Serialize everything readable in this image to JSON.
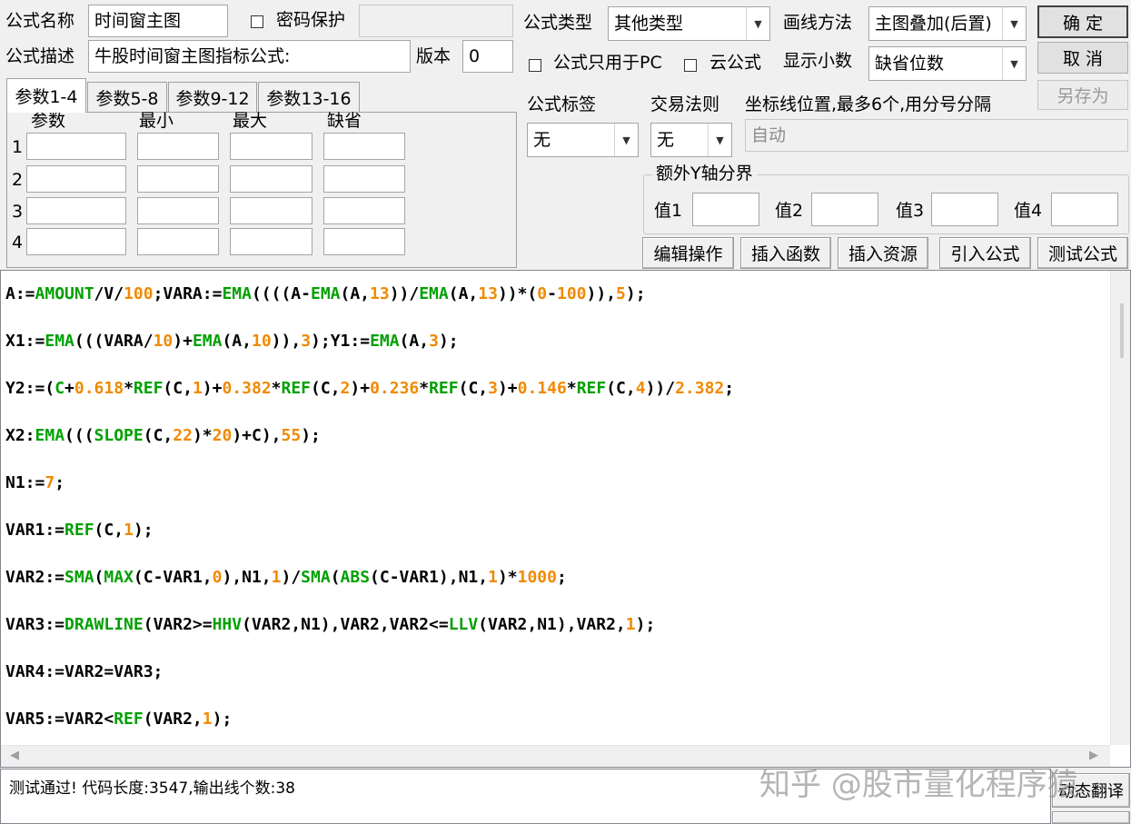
{
  "form": {
    "name_label": "公式名称",
    "name_value": "时间窗主图",
    "password_label": "密码保护",
    "type_label": "公式类型",
    "type_value": "其他类型",
    "draw_label": "画线方法",
    "draw_value": "主图叠加(后置)",
    "desc_label": "公式描述",
    "desc_value": "牛股时间窗主图指标公式:",
    "version_label": "版本",
    "version_value": "0",
    "pc_only_label": "公式只用于PC",
    "cloud_label": "云公式",
    "decimals_label": "显示小数",
    "decimals_value": "缺省位数",
    "tag_label": "公式标签",
    "tag_value": "无",
    "trade_rule_label": "交易法则",
    "trade_rule_value": "无",
    "coord_label": "坐标线位置,最多6个,用分号分隔",
    "coord_value": "自动",
    "extra_y_label": "额外Y轴分界",
    "val1": "值1",
    "val2": "值2",
    "val3": "值3",
    "val4": "值4"
  },
  "buttons": {
    "ok": "确 定",
    "cancel": "取 消",
    "save_as": "另存为",
    "edit_ops": "编辑操作",
    "insert_fn": "插入函数",
    "insert_res": "插入资源",
    "import": "引入公式",
    "test": "测试公式",
    "translate": "动态翻译"
  },
  "params": {
    "tabs": [
      "参数1-4",
      "参数5-8",
      "参数9-12",
      "参数13-16"
    ],
    "headers": [
      "参数",
      "最小",
      "最大",
      "缺省"
    ],
    "rows": [
      "1",
      "2",
      "3",
      "4"
    ]
  },
  "code": [
    [
      [
        "t",
        "A:="
      ],
      [
        "f",
        "AMOUNT"
      ],
      [
        "t",
        "/V/"
      ],
      [
        "n",
        "100"
      ],
      [
        "t",
        ";VARA:="
      ],
      [
        "f",
        "EMA"
      ],
      [
        "t",
        "((((A-"
      ],
      [
        "f",
        "EMA"
      ],
      [
        "t",
        "(A,"
      ],
      [
        "n",
        "13"
      ],
      [
        "t",
        "))/"
      ],
      [
        "f",
        "EMA"
      ],
      [
        "t",
        "(A,"
      ],
      [
        "n",
        "13"
      ],
      [
        "t",
        "))*("
      ],
      [
        "n",
        "0"
      ],
      [
        "t",
        "-"
      ],
      [
        "n",
        "100"
      ],
      [
        "t",
        ")),"
      ],
      [
        "n",
        "5"
      ],
      [
        "t",
        ");"
      ]
    ],
    [
      [
        "t",
        "X1:="
      ],
      [
        "f",
        "EMA"
      ],
      [
        "t",
        "(((VARA/"
      ],
      [
        "n",
        "10"
      ],
      [
        "t",
        ")+"
      ],
      [
        "f",
        "EMA"
      ],
      [
        "t",
        "(A,"
      ],
      [
        "n",
        "10"
      ],
      [
        "t",
        ")),"
      ],
      [
        "n",
        "3"
      ],
      [
        "t",
        ");Y1:="
      ],
      [
        "f",
        "EMA"
      ],
      [
        "t",
        "(A,"
      ],
      [
        "n",
        "3"
      ],
      [
        "t",
        ");"
      ]
    ],
    [
      [
        "t",
        "Y2:=("
      ],
      [
        "f",
        "C"
      ],
      [
        "t",
        "+"
      ],
      [
        "n",
        "0.618"
      ],
      [
        "t",
        "*"
      ],
      [
        "f",
        "REF"
      ],
      [
        "t",
        "(C,"
      ],
      [
        "n",
        "1"
      ],
      [
        "t",
        ")+"
      ],
      [
        "n",
        "0.382"
      ],
      [
        "t",
        "*"
      ],
      [
        "f",
        "REF"
      ],
      [
        "t",
        "(C,"
      ],
      [
        "n",
        "2"
      ],
      [
        "t",
        ")+"
      ],
      [
        "n",
        "0.236"
      ],
      [
        "t",
        "*"
      ],
      [
        "f",
        "REF"
      ],
      [
        "t",
        "(C,"
      ],
      [
        "n",
        "3"
      ],
      [
        "t",
        ")+"
      ],
      [
        "n",
        "0.146"
      ],
      [
        "t",
        "*"
      ],
      [
        "f",
        "REF"
      ],
      [
        "t",
        "(C,"
      ],
      [
        "n",
        "4"
      ],
      [
        "t",
        "))/"
      ],
      [
        "n",
        "2.382"
      ],
      [
        "t",
        ";"
      ]
    ],
    [
      [
        "t",
        "X2:"
      ],
      [
        "f",
        "EMA"
      ],
      [
        "t",
        "((("
      ],
      [
        "f",
        "SLOPE"
      ],
      [
        "t",
        "(C,"
      ],
      [
        "n",
        "22"
      ],
      [
        "t",
        ")*"
      ],
      [
        "n",
        "20"
      ],
      [
        "t",
        ")+C),"
      ],
      [
        "n",
        "55"
      ],
      [
        "t",
        ");"
      ]
    ],
    [
      [
        "t",
        "N1:="
      ],
      [
        "n",
        "7"
      ],
      [
        "t",
        ";"
      ]
    ],
    [
      [
        "t",
        "VAR1:="
      ],
      [
        "f",
        "REF"
      ],
      [
        "t",
        "(C,"
      ],
      [
        "n",
        "1"
      ],
      [
        "t",
        ");"
      ]
    ],
    [
      [
        "t",
        "VAR2:="
      ],
      [
        "f",
        "SMA"
      ],
      [
        "t",
        "("
      ],
      [
        "f",
        "MAX"
      ],
      [
        "t",
        "(C-VAR1,"
      ],
      [
        "n",
        "0"
      ],
      [
        "t",
        "),N1,"
      ],
      [
        "n",
        "1"
      ],
      [
        "t",
        ")/"
      ],
      [
        "f",
        "SMA"
      ],
      [
        "t",
        "("
      ],
      [
        "f",
        "ABS"
      ],
      [
        "t",
        "(C-VAR1),N1,"
      ],
      [
        "n",
        "1"
      ],
      [
        "t",
        ")*"
      ],
      [
        "n",
        "1000"
      ],
      [
        "t",
        ";"
      ]
    ],
    [
      [
        "t",
        "VAR3:="
      ],
      [
        "f",
        "DRAWLINE"
      ],
      [
        "t",
        "(VAR2>="
      ],
      [
        "f",
        "HHV"
      ],
      [
        "t",
        "(VAR2,N1),VAR2,VAR2<="
      ],
      [
        "f",
        "LLV"
      ],
      [
        "t",
        "(VAR2,N1),VAR2,"
      ],
      [
        "n",
        "1"
      ],
      [
        "t",
        ");"
      ]
    ],
    [
      [
        "t",
        "VAR4:=VAR2=VAR3;"
      ]
    ],
    [
      [
        "t",
        "VAR5:=VAR2<"
      ],
      [
        "f",
        "REF"
      ],
      [
        "t",
        "(VAR2,"
      ],
      [
        "n",
        "1"
      ],
      [
        "t",
        ");"
      ]
    ]
  ],
  "status": {
    "message": "测试通过! 代码长度:3547,输出线个数:38"
  },
  "watermark": "知乎 @股市量化程序猿"
}
